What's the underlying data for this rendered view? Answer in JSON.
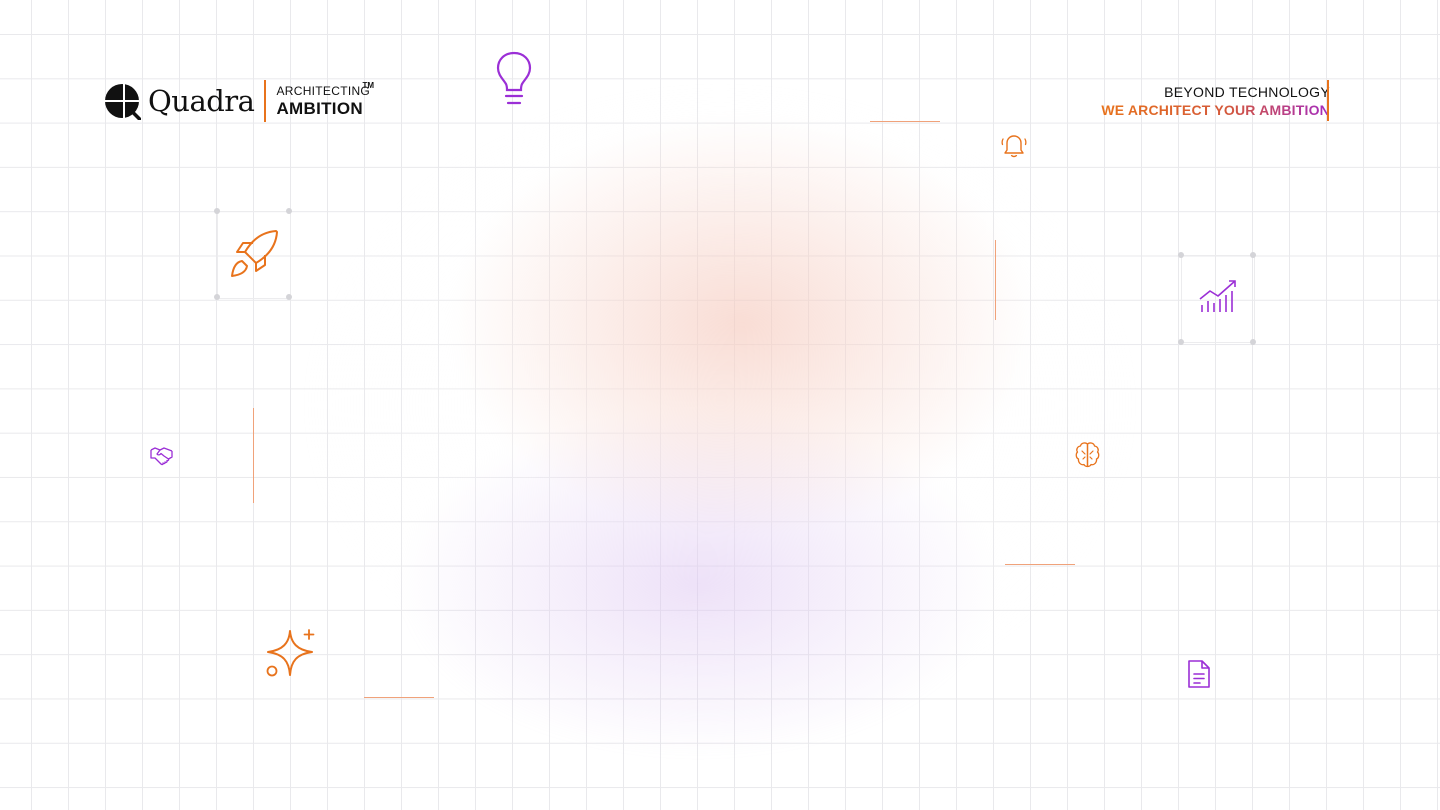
{
  "brand": {
    "name": "Quadra",
    "tag_small": "ARCHITECTING",
    "tag_big": "AMBITION",
    "trademark": "TM"
  },
  "tagline": {
    "line1": "BEYOND TECHNOLOGY",
    "line2": "WE ARCHITECT YOUR AMBITION"
  },
  "icons": [
    "lightbulb-icon",
    "bell-icon",
    "rocket-icon",
    "chart-icon",
    "handshake-icon",
    "brain-icon",
    "sparkle-icon",
    "document-icon"
  ],
  "colors": {
    "accent_orange": "#e8731c",
    "accent_purple": "#9b2fd6",
    "grid": "#e9e9ec"
  }
}
